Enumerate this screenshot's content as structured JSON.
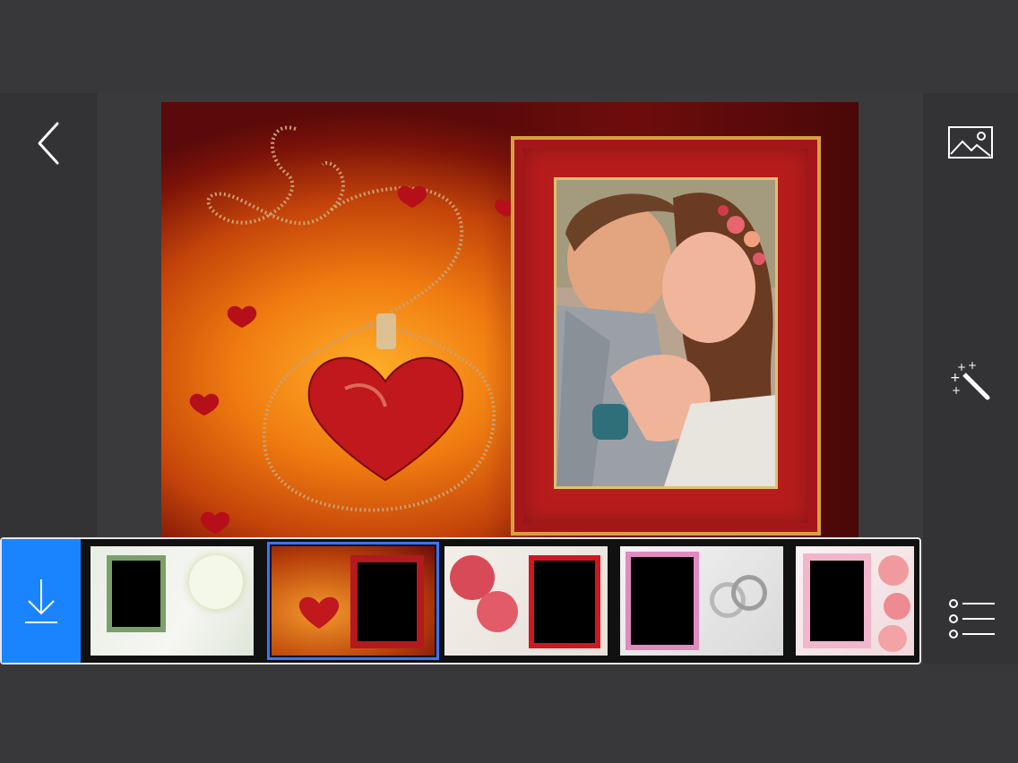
{
  "toolbar": {
    "back": "back-icon",
    "gallery": "image-icon",
    "magic": "magic-wand-icon",
    "list": "list-icon",
    "download": "download-icon"
  },
  "accent_color": "#1a84ff",
  "thumbnails": [
    {
      "name": "frame-green-lily",
      "selected": false
    },
    {
      "name": "frame-red-heart-necklace",
      "selected": true
    },
    {
      "name": "frame-red-roses",
      "selected": false
    },
    {
      "name": "frame-silver-rings",
      "selected": false
    },
    {
      "name": "frame-pink-roses",
      "selected": false
    }
  ]
}
